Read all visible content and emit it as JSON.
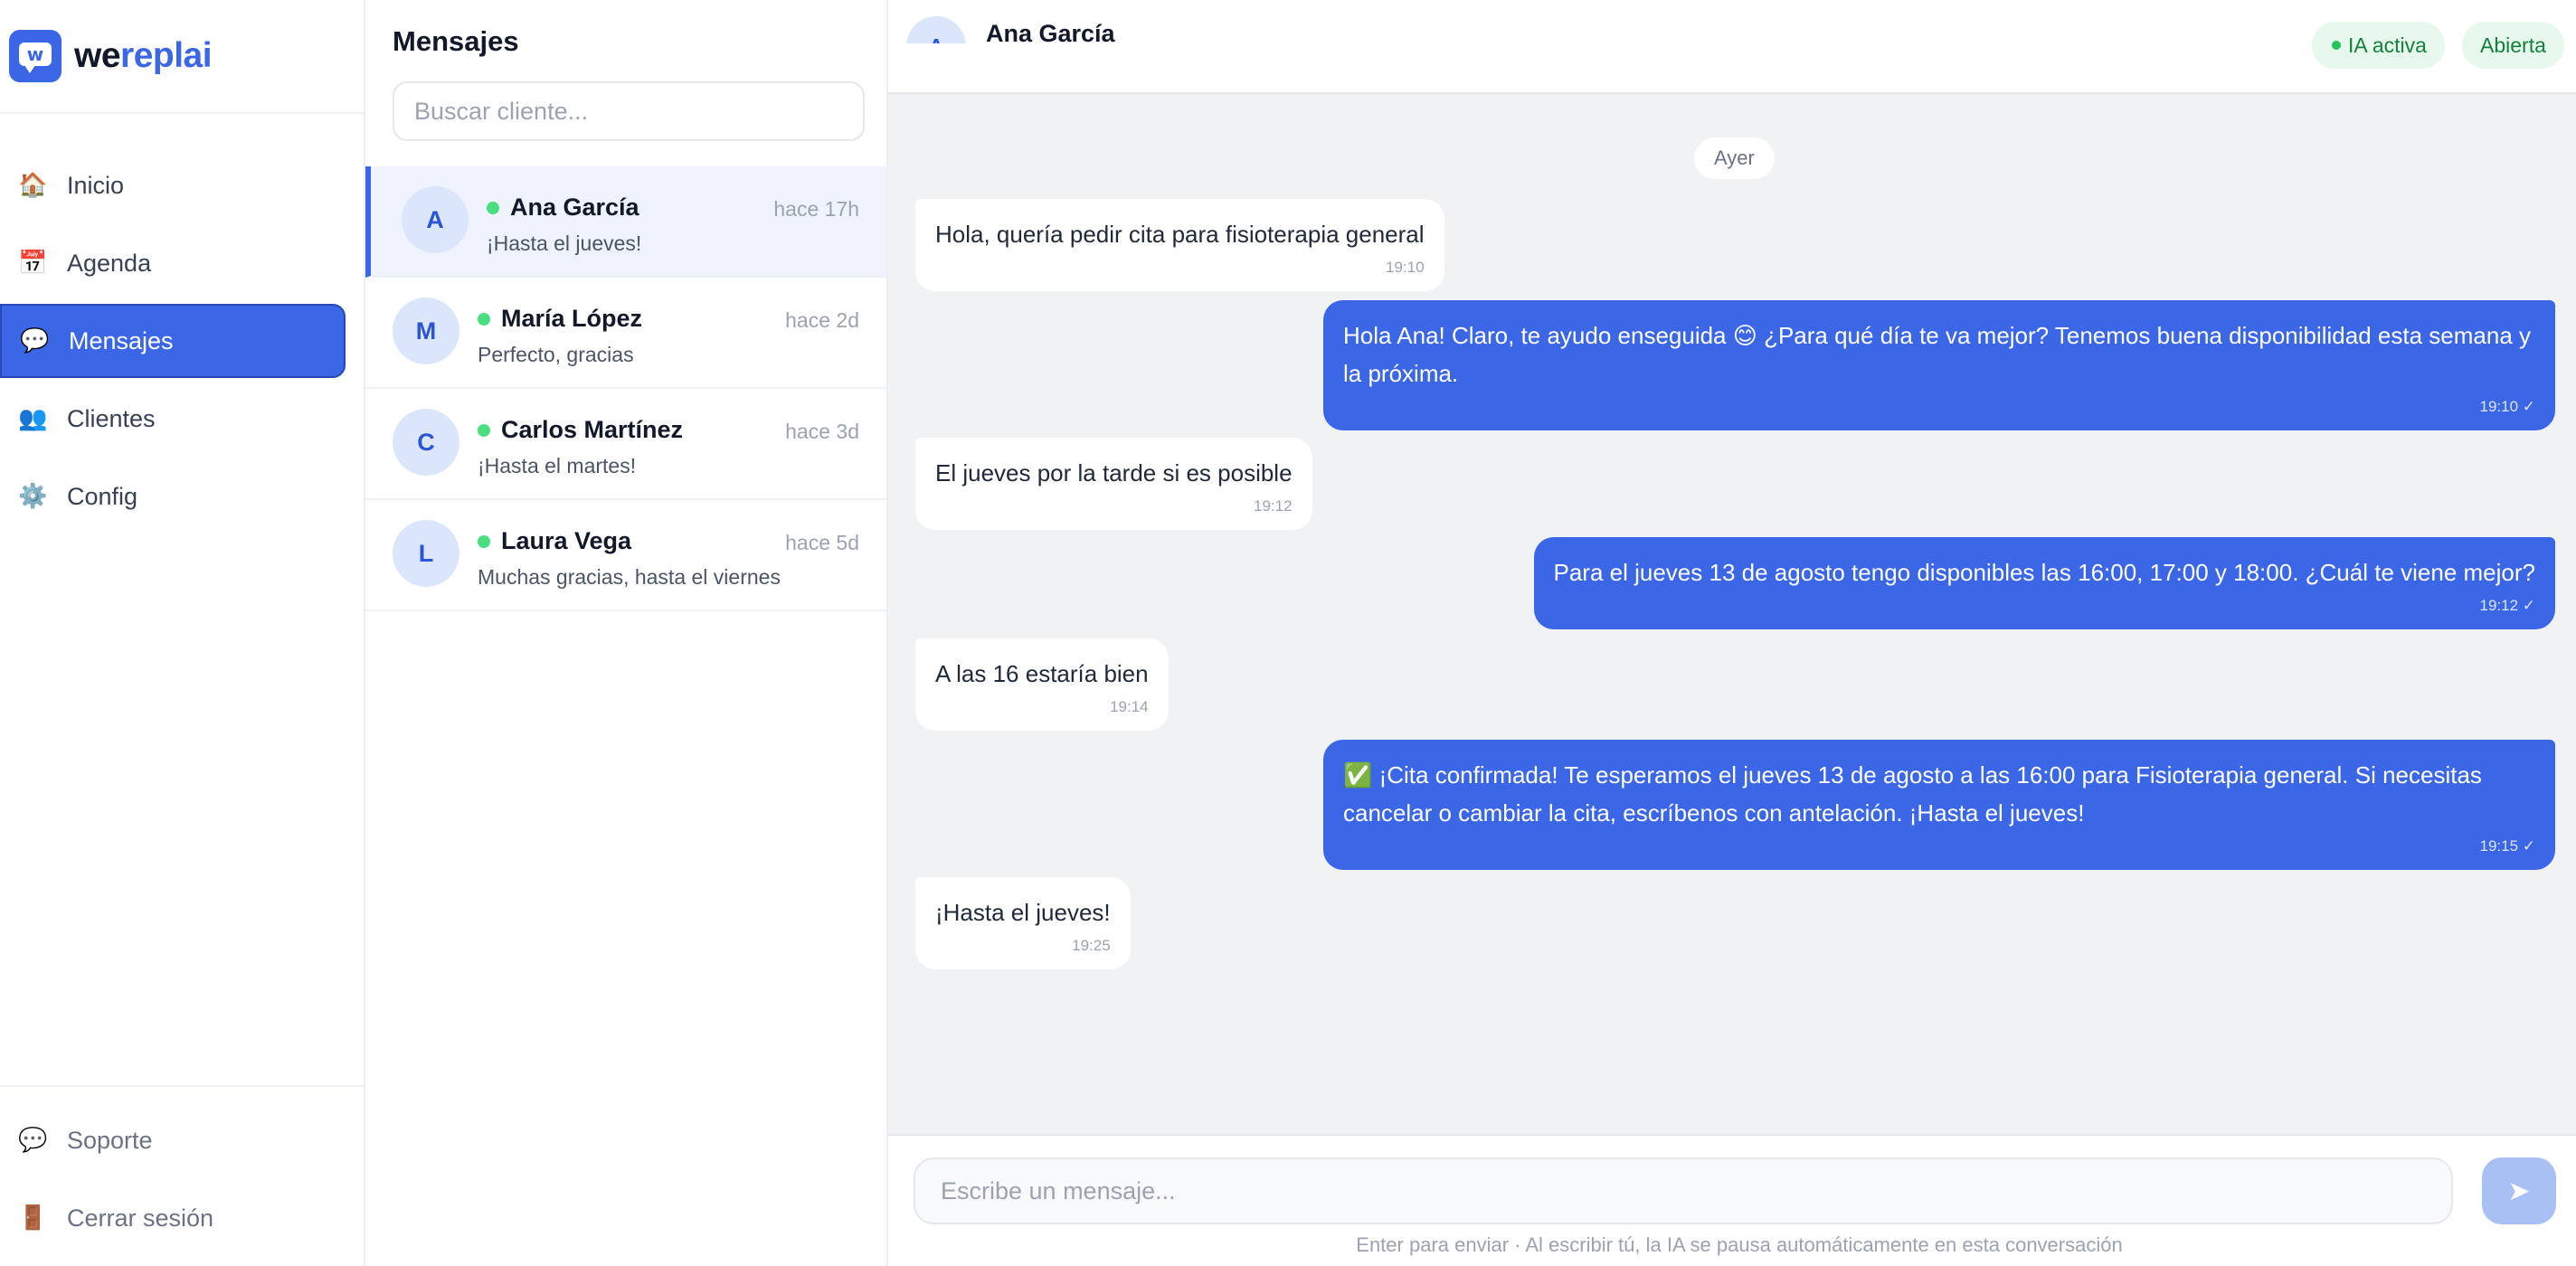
{
  "brand": {
    "mark": "w",
    "name_part1": "we",
    "name_part2": "replai"
  },
  "sidebar": {
    "items": [
      {
        "label": "Inicio",
        "icon": "🏠"
      },
      {
        "label": "Agenda",
        "icon": "📅"
      },
      {
        "label": "Mensajes",
        "icon": "💬"
      },
      {
        "label": "Clientes",
        "icon": "👥"
      },
      {
        "label": "Config",
        "icon": "⚙️"
      }
    ],
    "footer": [
      {
        "label": "Soporte",
        "icon": "💬"
      },
      {
        "label": "Cerrar sesión",
        "icon": "🚪"
      }
    ]
  },
  "conversations": {
    "title": "Mensajes",
    "search_placeholder": "Buscar cliente...",
    "items": [
      {
        "initial": "A",
        "name": "Ana García",
        "time": "hace 17h",
        "preview": "¡Hasta el jueves!"
      },
      {
        "initial": "M",
        "name": "María López",
        "time": "hace 2d",
        "preview": "Perfecto, gracias"
      },
      {
        "initial": "C",
        "name": "Carlos Martínez",
        "time": "hace 3d",
        "preview": "¡Hasta el martes!"
      },
      {
        "initial": "L",
        "name": "Laura Vega",
        "time": "hace 5d",
        "preview": "Muchas gracias, hasta el viernes"
      }
    ]
  },
  "chat": {
    "avatar_initial": "A",
    "name": "Ana García",
    "ai_badge": "IA activa",
    "status_badge": "Abierta",
    "day_label": "Ayer",
    "messages": [
      {
        "dir": "in",
        "text": "Hola, quería pedir cita para fisioterapia general",
        "time": "19:10"
      },
      {
        "dir": "out",
        "text": "Hola Ana! Claro, te ayudo enseguida 😊 ¿Para qué día te va mejor? Tenemos buena disponibilidad esta semana y la próxima.",
        "time": "19:10 ✓"
      },
      {
        "dir": "in",
        "text": "El jueves por la tarde si es posible",
        "time": "19:12"
      },
      {
        "dir": "out",
        "text": "Para el jueves 13 de agosto tengo disponibles las 16:00, 17:00 y 18:00. ¿Cuál te viene mejor?",
        "time": "19:12 ✓"
      },
      {
        "dir": "in",
        "text": "A las 16 estaría bien",
        "time": "19:14"
      },
      {
        "dir": "out",
        "text": "✅ ¡Cita confirmada! Te esperamos el jueves 13 de agosto a las 16:00 para Fisioterapia general. Si necesitas cancelar o cambiar la cita, escríbenos con antelación. ¡Hasta el jueves!",
        "time": "19:15 ✓"
      },
      {
        "dir": "in",
        "text": "¡Hasta el jueves!",
        "time": "19:25"
      }
    ],
    "composer_placeholder": "Escribe un mensaje...",
    "send_icon": "➤",
    "hint": "Enter para enviar · Al escribir tú, la IA se pausa automáticamente en esta conversación"
  }
}
